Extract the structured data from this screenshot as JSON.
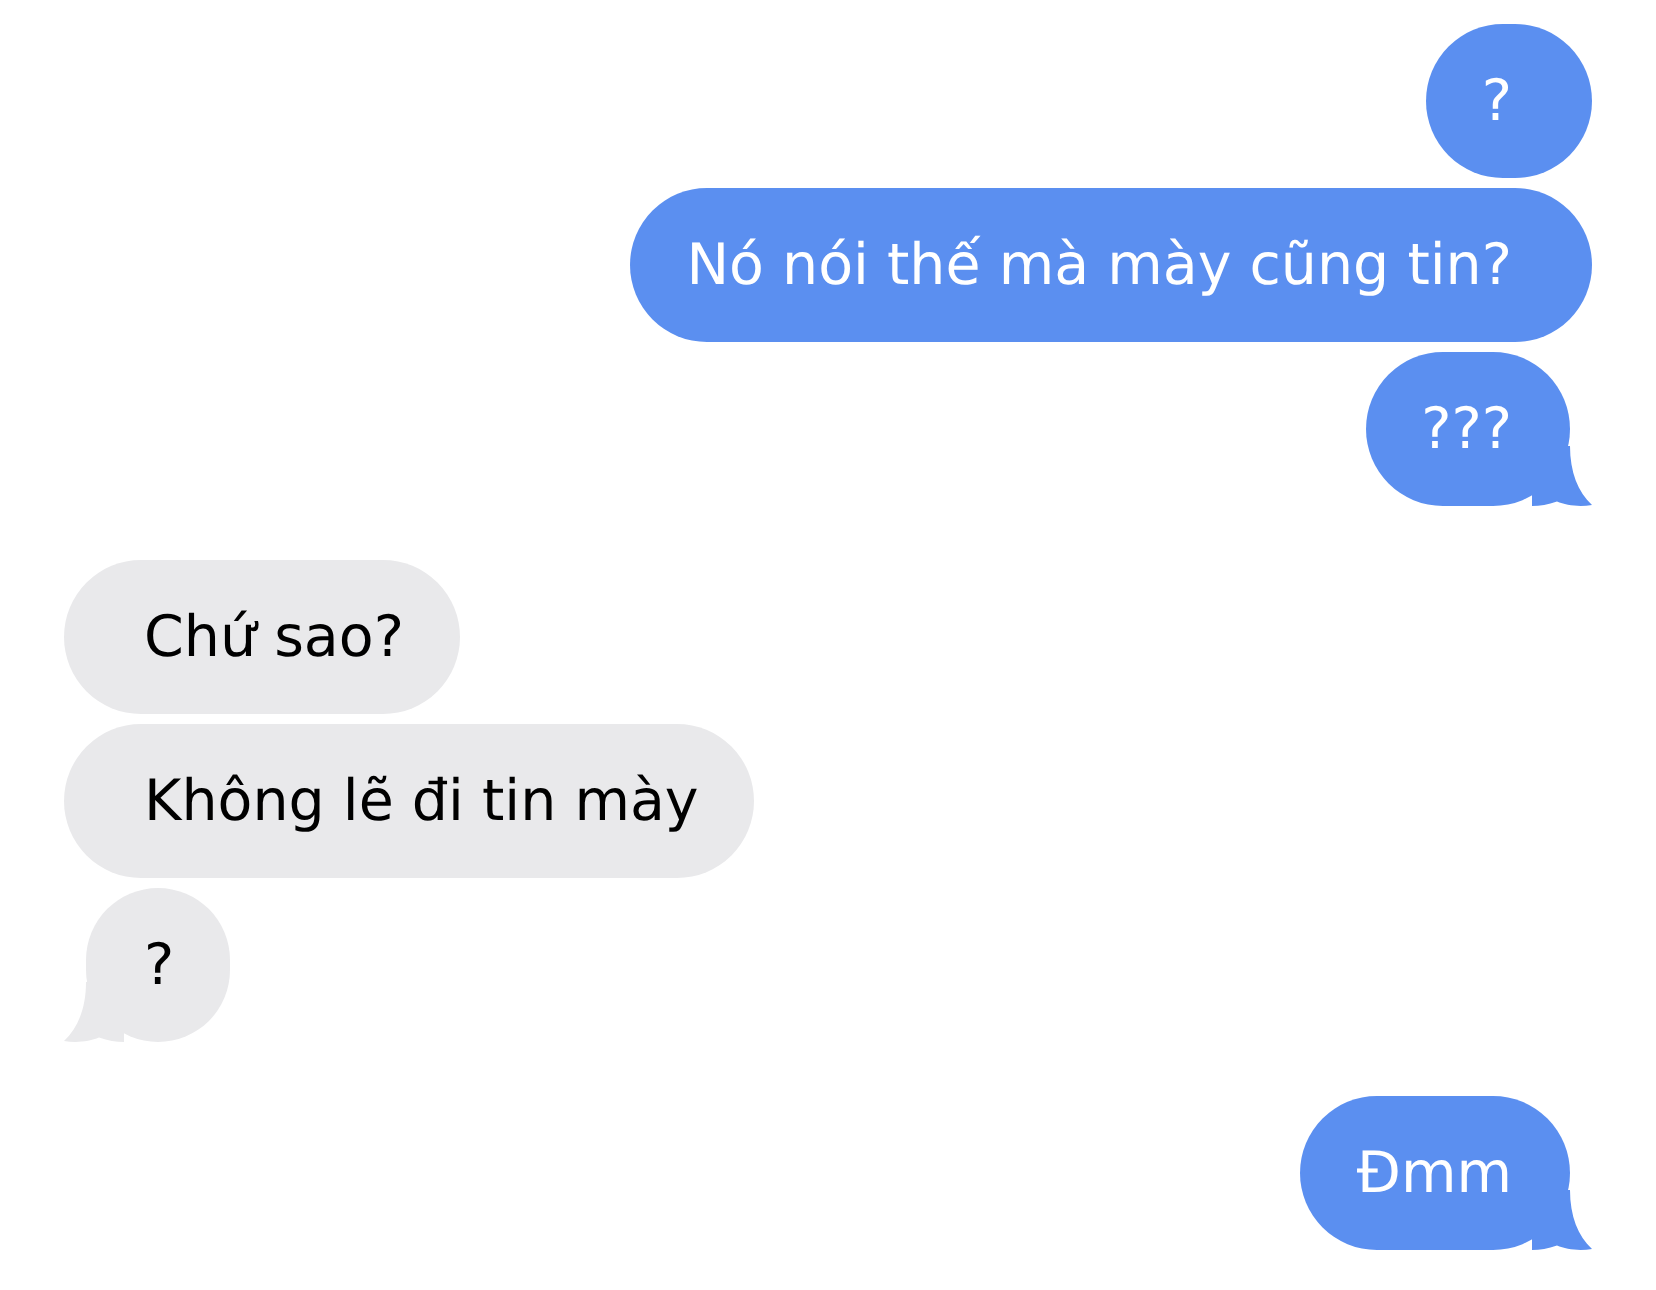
{
  "messages": [
    {
      "kind": "sent",
      "text": "?",
      "tail": false
    },
    {
      "kind": "sent",
      "text": "Nó nói thế mà mày cũng tin?",
      "tail": false
    },
    {
      "kind": "sent",
      "text": "???",
      "tail": true
    },
    {
      "kind": "received",
      "text": "Chứ sao?",
      "tail": false
    },
    {
      "kind": "received",
      "text": "Không lẽ đi tin mày",
      "tail": false
    },
    {
      "kind": "received",
      "text": "?",
      "tail": true
    },
    {
      "kind": "sent",
      "text": "Đmm",
      "tail": true
    }
  ]
}
